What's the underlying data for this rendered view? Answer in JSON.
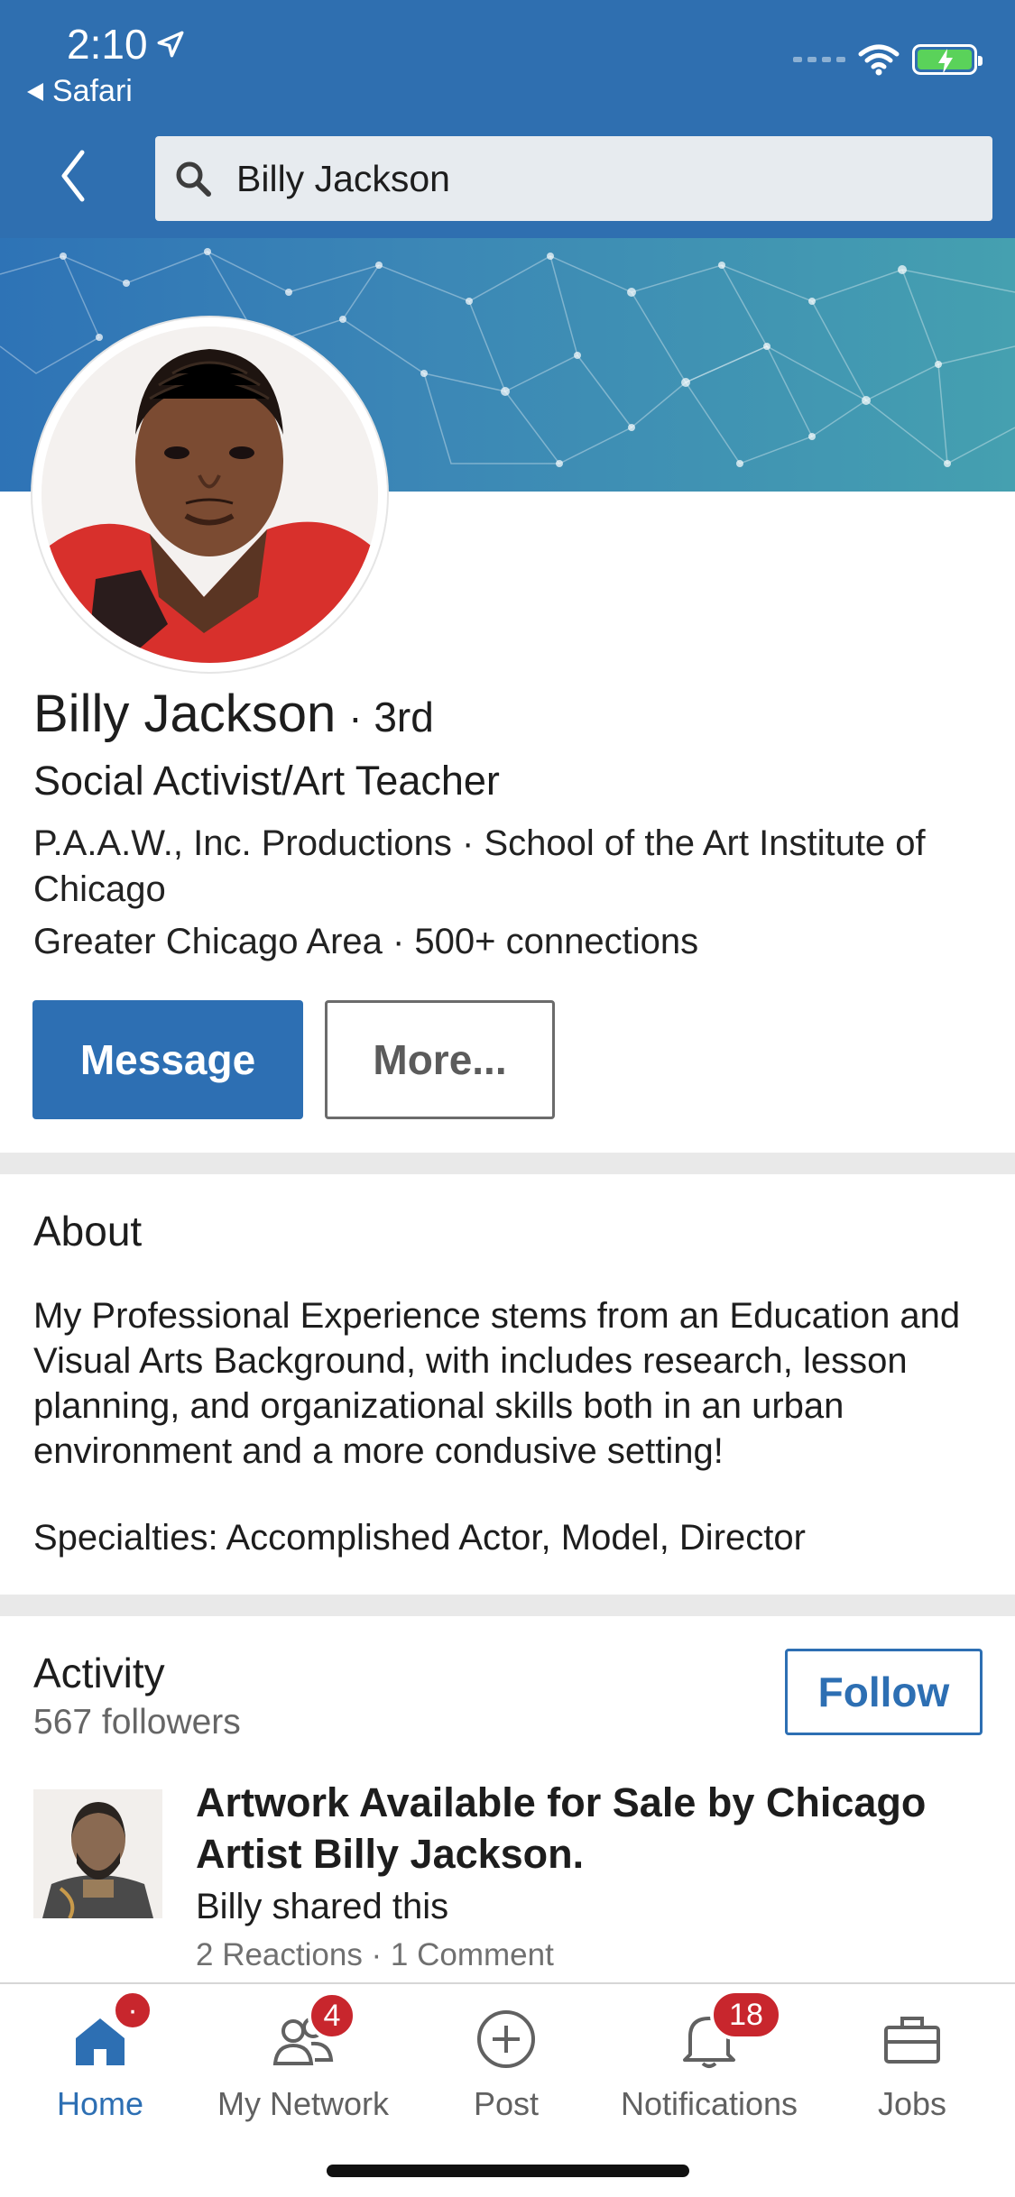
{
  "status_bar": {
    "time": "2:10",
    "back_app": "Safari"
  },
  "search": {
    "value": "Billy Jackson"
  },
  "profile": {
    "name": "Billy Jackson",
    "degree": "· 3rd",
    "headline": "Social Activist/Art Teacher",
    "company": "P.A.A.W., Inc. Productions · School of the Art Institute of Chicago",
    "location": "Greater Chicago Area · 500+ connections",
    "message_label": "Message",
    "more_label": "More..."
  },
  "about": {
    "title": "About",
    "text": "My Professional Experience stems from an Education and Visual Arts Background, with includes research, lesson planning, and organizational skills both in an urban environment and a more condusive setting!",
    "specialties": "Specialties: Accomplished Actor, Model, Director"
  },
  "activity": {
    "title": "Activity",
    "followers": "567 followers",
    "follow_label": "Follow",
    "post": {
      "title": "Artwork Available for Sale by Chicago Artist Billy Jackson.",
      "subtitle": "Billy shared this",
      "meta": "2 Reactions · 1 Comment"
    }
  },
  "tabbar": {
    "home": {
      "label": "Home",
      "icon": "home-icon",
      "badge": "·"
    },
    "network": {
      "label": "My Network",
      "icon": "people-icon",
      "badge": "4"
    },
    "post": {
      "label": "Post",
      "icon": "plus-circle-icon"
    },
    "notifications": {
      "label": "Notifications",
      "icon": "bell-icon",
      "badge": "18"
    },
    "jobs": {
      "label": "Jobs",
      "icon": "briefcase-icon"
    }
  },
  "colors": {
    "brand_blue": "#2d6fb3",
    "header_blue": "#2f6fb0",
    "badge_red": "#c8262d"
  }
}
